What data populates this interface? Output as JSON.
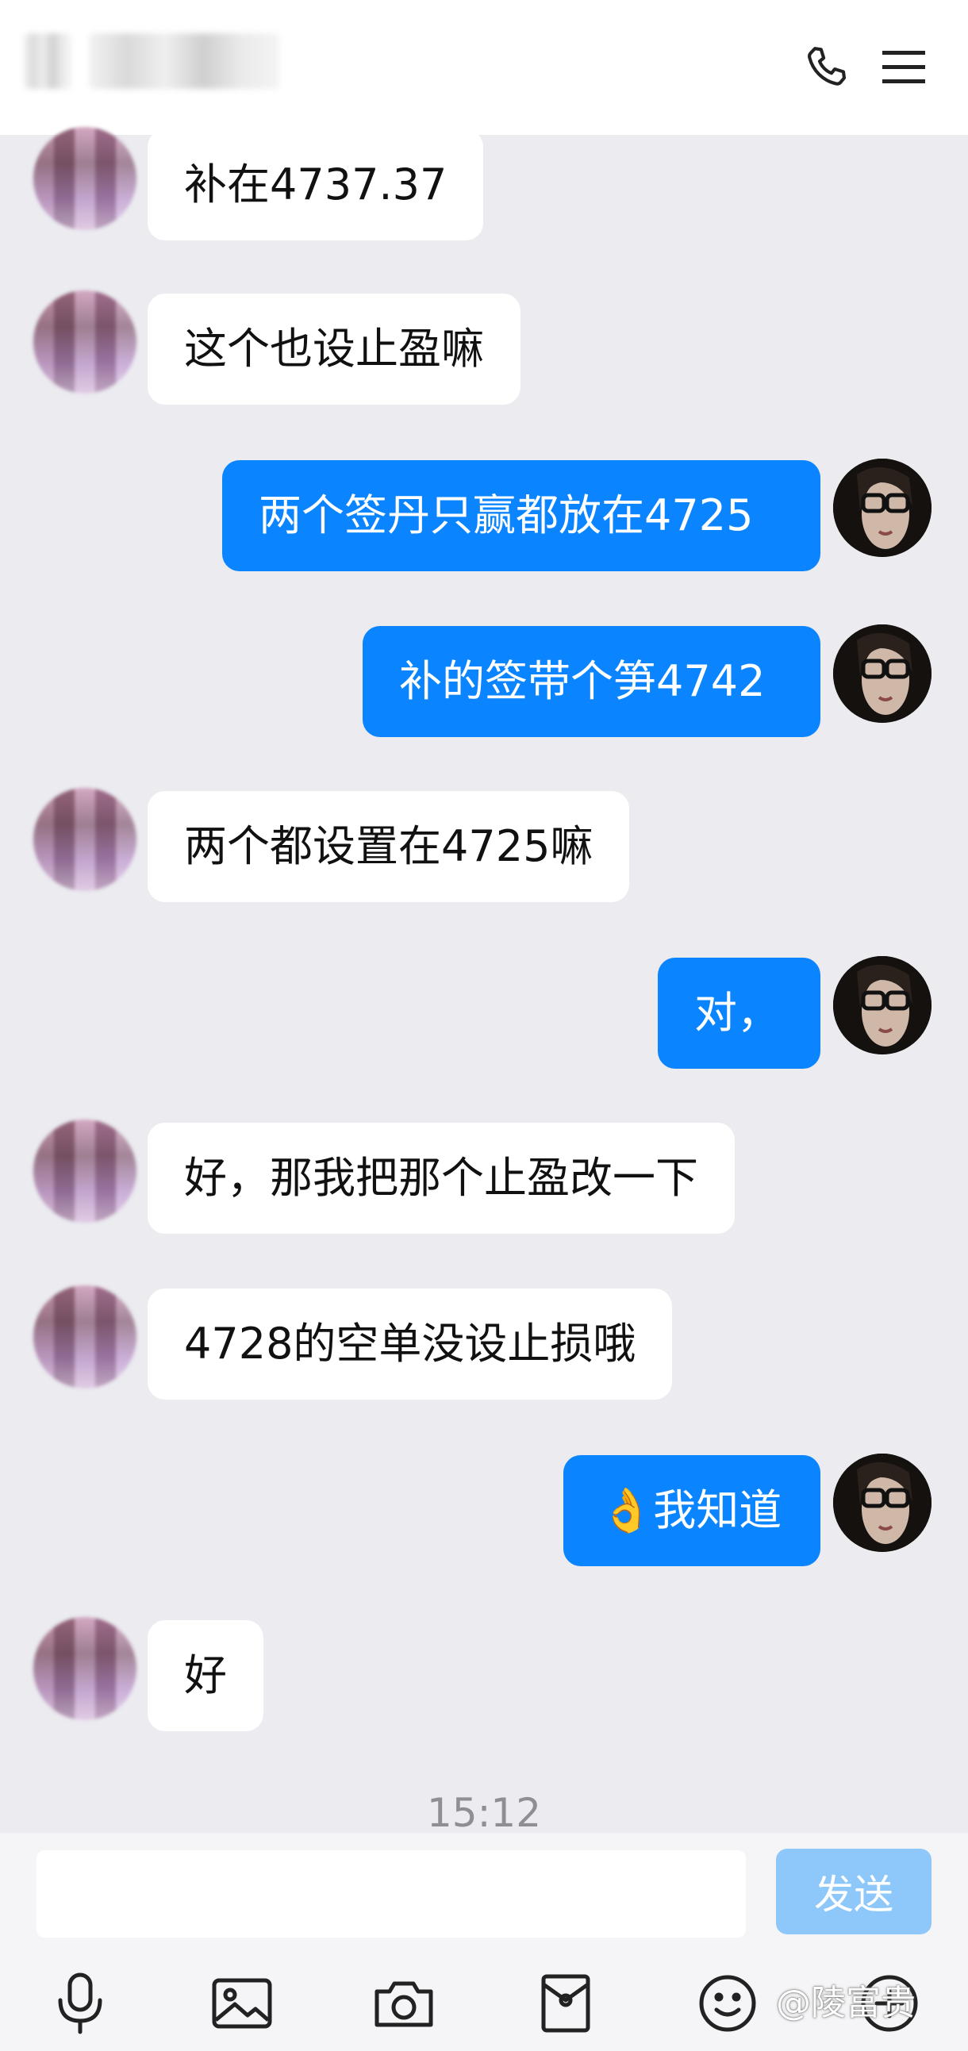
{
  "header": {
    "contact_name": "",
    "icons": [
      "phone-icon",
      "menu-icon"
    ]
  },
  "messages": [
    {
      "side": "left",
      "text": "补在4737.37"
    },
    {
      "side": "left",
      "text": "这个也设止盈嘛"
    },
    {
      "side": "right",
      "text": "两个签丹只赢都放在4725"
    },
    {
      "side": "right",
      "text": "补的签带个笋4742"
    },
    {
      "side": "left",
      "text": "两个都设置在4725嘛"
    },
    {
      "side": "right",
      "text": "对，"
    },
    {
      "side": "left",
      "text": "好，那我把那个止盈改一下"
    },
    {
      "side": "left",
      "text": "4728的空单没设止损哦"
    },
    {
      "side": "right",
      "text": "👌我知道"
    },
    {
      "side": "left",
      "text": "好"
    }
  ],
  "timestamp": "15:12",
  "composer": {
    "input_value": "",
    "send_label": "发送"
  },
  "toolbar": [
    "microphone-icon",
    "image-icon",
    "camera-icon",
    "red-packet-icon",
    "emoji-icon"
  ],
  "watermark": "@陵富贵",
  "colors": {
    "outgoing_bubble": "#0a84ff",
    "incoming_bubble": "#ffffff",
    "background": "#ebebf0",
    "send_button": "#8ec8fb"
  }
}
